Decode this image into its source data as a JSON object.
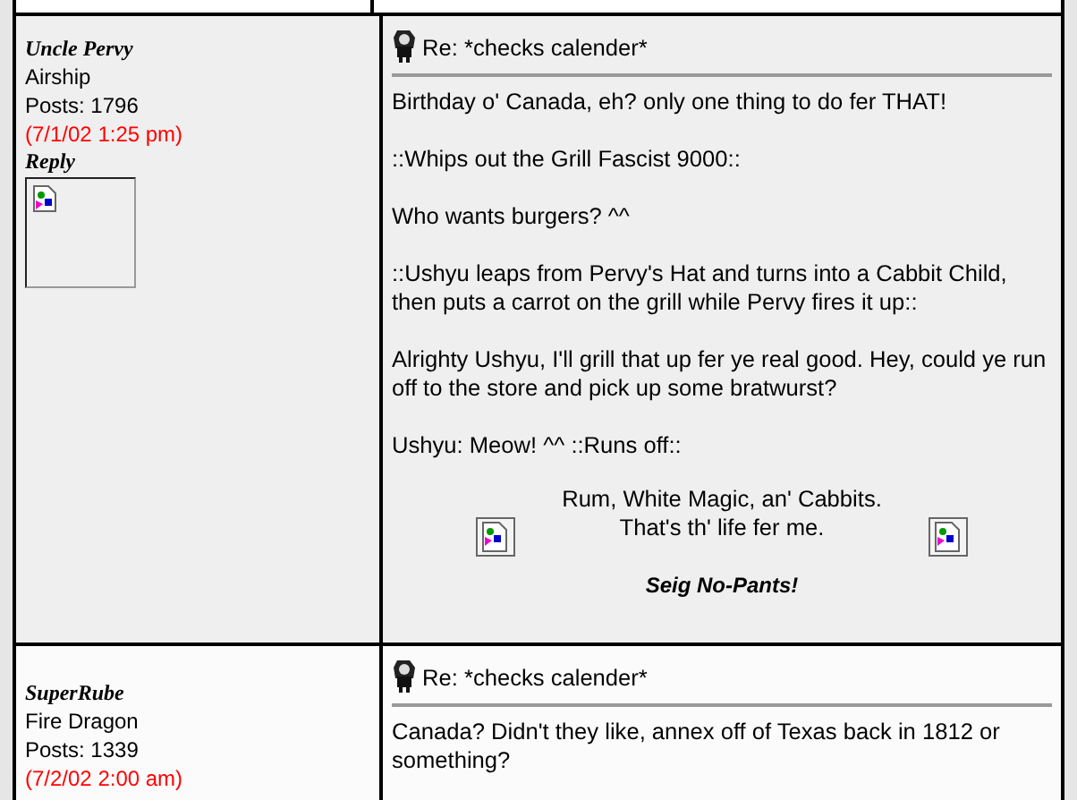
{
  "posts": [
    {
      "author": "Uncle Pervy",
      "rank": "Airship",
      "posts": "Posts: 1796",
      "date": "(7/1/02 1:25 pm)",
      "reply": "Reply",
      "avatar": true,
      "title": "Re: *checks calender*",
      "body": [
        "Birthday o' Canada, eh? only one thing to do fer THAT!",
        "::Whips out the Grill Fascist 9000::",
        "Who wants burgers? ^^",
        "::Ushyu leaps from Pervy's Hat and turns into a Cabbit Child, then puts a carrot on the grill while Pervy fires it up::",
        "Alrighty Ushyu, I'll grill that up fer ye real good. Hey, could ye run off to the store and pick up some bratwurst?",
        "Ushyu: Meow! ^^ ::Runs off::"
      ],
      "signature": {
        "lines": [
          "Rum, White Magic, an' Cabbits.",
          "That's th' life fer me."
        ],
        "closing": "Seig No-Pants!"
      }
    },
    {
      "author": "SuperRube",
      "rank": "Fire Dragon",
      "posts": "Posts: 1339",
      "date": "(7/2/02 2:00 am)",
      "title": "Re: *checks calender*",
      "body": [
        "Canada? Didn't they like, annex off of Texas back in 1812 or something?"
      ]
    }
  ]
}
